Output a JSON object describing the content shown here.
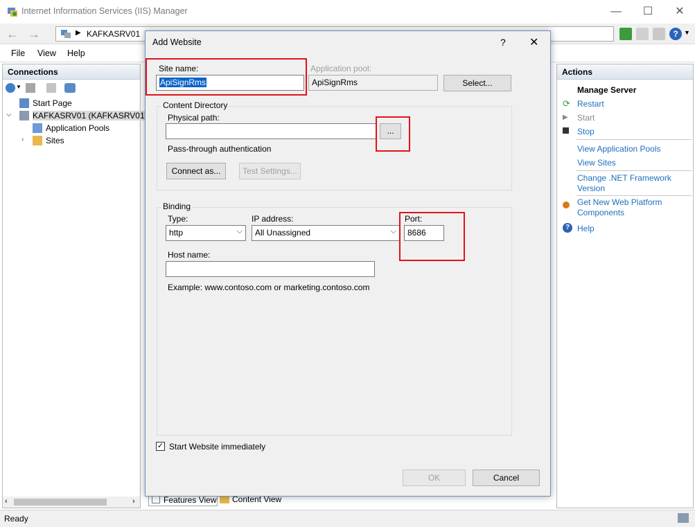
{
  "window": {
    "title": "Internet Information Services (IIS) Manager",
    "minimize": "—",
    "maximize": "☐",
    "close": "✕"
  },
  "nav": {
    "back": "←",
    "forward": "→",
    "breadcrumb": "KAFKASRV01",
    "help_icon": "?"
  },
  "menu": {
    "file": "File",
    "view": "View",
    "help": "Help"
  },
  "connections": {
    "title": "Connections",
    "tree": {
      "start_page": "Start Page",
      "server": "KAFKASRV01 (KAFKASRV01\\A",
      "app_pools": "Application Pools",
      "sites": "Sites"
    }
  },
  "actions": {
    "title": "Actions",
    "section": "Manage Server",
    "restart": "Restart",
    "start": "Start",
    "stop": "Stop",
    "view_app_pools": "View Application Pools",
    "view_sites": "View Sites",
    "change_net_1": "Change .NET Framework",
    "change_net_2": "Version",
    "get_new_1": "Get New Web Platform",
    "get_new_2": "Components",
    "help": "Help"
  },
  "view_tabs": {
    "features": "Features View",
    "content": "Content View"
  },
  "status": {
    "text": "Ready"
  },
  "dialog": {
    "title": "Add Website",
    "help_btn": "?",
    "close_btn": "✕",
    "site_name_label": "Site name:",
    "site_name_value": "ApiSignRms",
    "app_pool_label": "Application pool:",
    "app_pool_value": "ApiSignRms",
    "select_button": "Select...",
    "content_directory": "Content Directory",
    "physical_path_label": "Physical path:",
    "physical_path_value": "",
    "browse_button": "...",
    "pass_through": "Pass-through authentication",
    "connect_as": "Connect as...",
    "test_settings": "Test Settings...",
    "binding": "Binding",
    "type_label": "Type:",
    "type_value": "http",
    "ip_label": "IP address:",
    "ip_value": "All Unassigned",
    "port_label": "Port:",
    "port_value": "8686",
    "host_label": "Host name:",
    "host_value": "",
    "example": "Example: www.contoso.com or marketing.contoso.com",
    "start_immediately": "Start Website immediately",
    "start_checked": true,
    "ok": "OK",
    "cancel": "Cancel"
  },
  "colors": {
    "highlight": "#e0121a",
    "link": "#1e6fbf",
    "selection": "#0a63c9"
  }
}
